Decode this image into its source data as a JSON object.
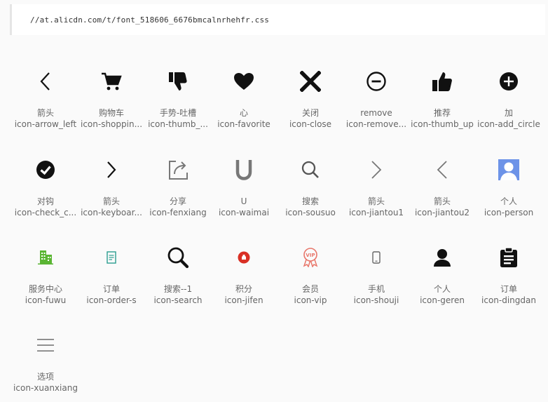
{
  "header": {
    "css_url": "//at.alicdn.com/t/font_518606_6676bmcalnrhehfr.css"
  },
  "icons": [
    {
      "cn": "箭头",
      "en": "icon-arrow_left",
      "icon": "arrow-left-icon"
    },
    {
      "cn": "购物车",
      "en": "icon-shoppin...",
      "icon": "shopping-cart-icon"
    },
    {
      "cn": "手势-吐槽",
      "en": "icon-thumb_...",
      "icon": "thumb-down-icon"
    },
    {
      "cn": "心",
      "en": "icon-favorite",
      "icon": "heart-icon"
    },
    {
      "cn": "关闭",
      "en": "icon-close",
      "icon": "close-icon"
    },
    {
      "cn": "remove",
      "en": "icon-remove...",
      "icon": "remove-circle-icon"
    },
    {
      "cn": "推荐",
      "en": "icon-thumb_up",
      "icon": "thumb-up-icon"
    },
    {
      "cn": "加",
      "en": "icon-add_circle",
      "icon": "add-circle-icon"
    },
    {
      "cn": "对钩",
      "en": "icon-check_c...",
      "icon": "check-circle-icon"
    },
    {
      "cn": "箭头",
      "en": "icon-keyboar...",
      "icon": "chevron-right-icon"
    },
    {
      "cn": "分享",
      "en": "icon-fenxiang",
      "icon": "share-icon"
    },
    {
      "cn": "U",
      "en": "icon-waimai",
      "icon": "u-letter-icon"
    },
    {
      "cn": "搜索",
      "en": "icon-sousuo",
      "icon": "search-icon"
    },
    {
      "cn": "箭头",
      "en": "icon-jiantou1",
      "icon": "arrow-right-thin-icon"
    },
    {
      "cn": "箭头",
      "en": "icon-jiantou2",
      "icon": "arrow-left-thin-icon"
    },
    {
      "cn": "个人",
      "en": "icon-person",
      "icon": "person-square-icon"
    },
    {
      "cn": "服务中心",
      "en": "icon-fuwu",
      "icon": "building-icon"
    },
    {
      "cn": "订单",
      "en": "icon-order-s",
      "icon": "order-document-icon"
    },
    {
      "cn": "搜索--1",
      "en": "icon-search",
      "icon": "search-bold-icon"
    },
    {
      "cn": "积分",
      "en": "icon-jifen",
      "icon": "points-bag-icon"
    },
    {
      "cn": "会员",
      "en": "icon-vip",
      "icon": "vip-badge-icon"
    },
    {
      "cn": "手机",
      "en": "icon-shouji",
      "icon": "mobile-phone-icon"
    },
    {
      "cn": "个人",
      "en": "icon-geren",
      "icon": "user-icon"
    },
    {
      "cn": "订单",
      "en": "icon-dingdan",
      "icon": "clipboard-icon"
    },
    {
      "cn": "选项",
      "en": "icon-xuanxiang",
      "icon": "menu-lines-icon"
    }
  ],
  "colors": {
    "green": "#5ab533",
    "teal": "#2a9d8f",
    "red": "#d93025",
    "salmon": "#e8776b",
    "blue": "#6d93e8"
  }
}
